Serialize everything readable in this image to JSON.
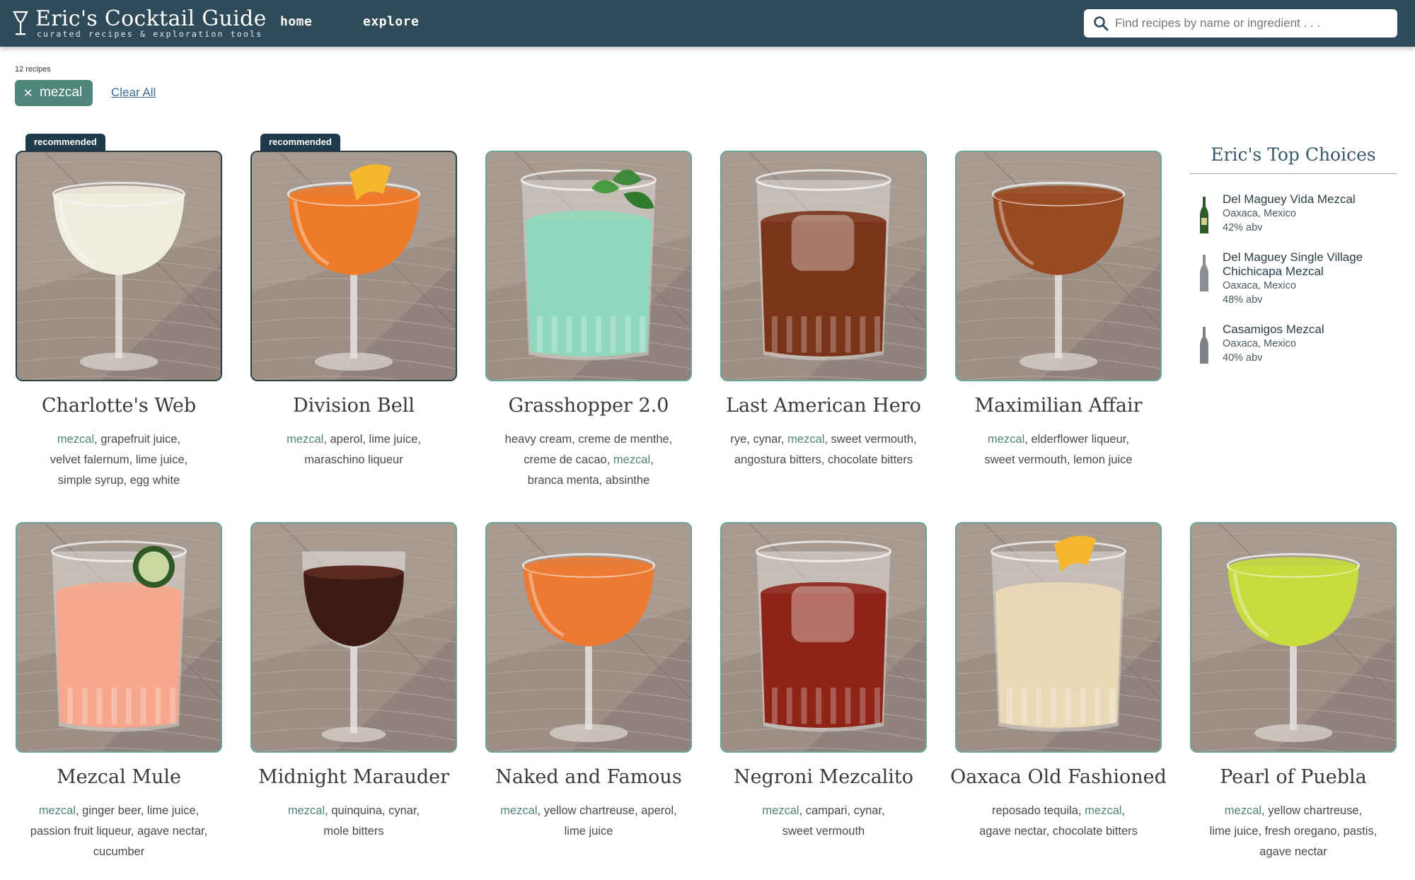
{
  "header": {
    "title": "Eric's Cocktail Guide",
    "subtitle": "curated recipes & exploration tools",
    "nav": {
      "home": "home",
      "explore": "explore"
    },
    "search_placeholder": "Find recipes by name or ingredient . . ."
  },
  "filters": {
    "count": "12 recipes",
    "active_filter": "mezcal",
    "clear_label": "Clear All"
  },
  "colors": {
    "header": "#2f4b5a",
    "accent": "#4f857b",
    "badge": "#1f3a4a"
  },
  "cards": [
    {
      "name": "Charlotte's Web",
      "badge": "recommended",
      "ingredient_lines": [
        [
          "mezcal",
          "grapefruit juice"
        ],
        [
          "velvet falernum",
          "lime juice"
        ],
        [
          "simple syrup",
          "egg white"
        ]
      ]
    },
    {
      "name": "Division Bell",
      "badge": "recommended",
      "ingredient_lines": [
        [
          "mezcal",
          "aperol",
          "lime juice"
        ],
        [
          "maraschino liqueur"
        ]
      ]
    },
    {
      "name": "Grasshopper 2.0",
      "badge": "",
      "ingredient_lines": [
        [
          "heavy cream",
          "creme de menthe"
        ],
        [
          "creme de cacao",
          "mezcal"
        ],
        [
          "branca menta",
          "absinthe"
        ]
      ]
    },
    {
      "name": "Last American Hero",
      "badge": "",
      "ingredient_lines": [
        [
          "rye",
          "cynar",
          "mezcal",
          "sweet vermouth"
        ],
        [
          "angostura bitters",
          "chocolate bitters"
        ]
      ]
    },
    {
      "name": "Maximilian Affair",
      "badge": "",
      "ingredient_lines": [
        [
          "mezcal",
          "elderflower liqueur"
        ],
        [
          "sweet vermouth",
          "lemon juice"
        ]
      ]
    },
    {
      "name": "Mezcal Mule",
      "badge": "",
      "ingredient_lines": [
        [
          "mezcal",
          "ginger beer",
          "lime juice"
        ],
        [
          "passion fruit liqueur",
          "agave nectar"
        ],
        [
          "cucumber"
        ]
      ]
    },
    {
      "name": "Midnight Marauder",
      "badge": "",
      "ingredient_lines": [
        [
          "mezcal",
          "quinquina",
          "cynar"
        ],
        [
          "mole bitters"
        ]
      ]
    },
    {
      "name": "Naked and Famous",
      "badge": "",
      "ingredient_lines": [
        [
          "mezcal",
          "yellow chartreuse",
          "aperol"
        ],
        [
          "lime juice"
        ]
      ]
    },
    {
      "name": "Negroni Mezcalito",
      "badge": "",
      "ingredient_lines": [
        [
          "mezcal",
          "campari",
          "cynar"
        ],
        [
          "sweet vermouth"
        ]
      ]
    },
    {
      "name": "Oaxaca Old Fashioned",
      "badge": "",
      "ingredient_lines": [
        [
          "reposado tequila",
          "mezcal"
        ],
        [
          "agave nectar",
          "chocolate bitters"
        ]
      ]
    },
    {
      "name": "Pearl of Puebla",
      "badge": "",
      "ingredient_lines": [
        [
          "mezcal",
          "yellow chartreuse"
        ],
        [
          "lime juice",
          "fresh oregano",
          "pastis"
        ],
        [
          "agave nectar"
        ]
      ]
    }
  ],
  "sidebar": {
    "title": "Eric's Top Choices",
    "items": [
      {
        "name": "Del Maguey Vida Mezcal",
        "origin": "Oaxaca, Mexico",
        "abv": "42% abv",
        "bottle_color": "#2f5a2a"
      },
      {
        "name": "Del Maguey Single Village Chichicapa Mezcal",
        "origin": "Oaxaca, Mexico",
        "abv": "48% abv",
        "bottle_color": "#8a8f92"
      },
      {
        "name": "Casamigos Mezcal",
        "origin": "Oaxaca, Mexico",
        "abv": "40% abv",
        "bottle_color": "#7d8286"
      }
    ]
  }
}
